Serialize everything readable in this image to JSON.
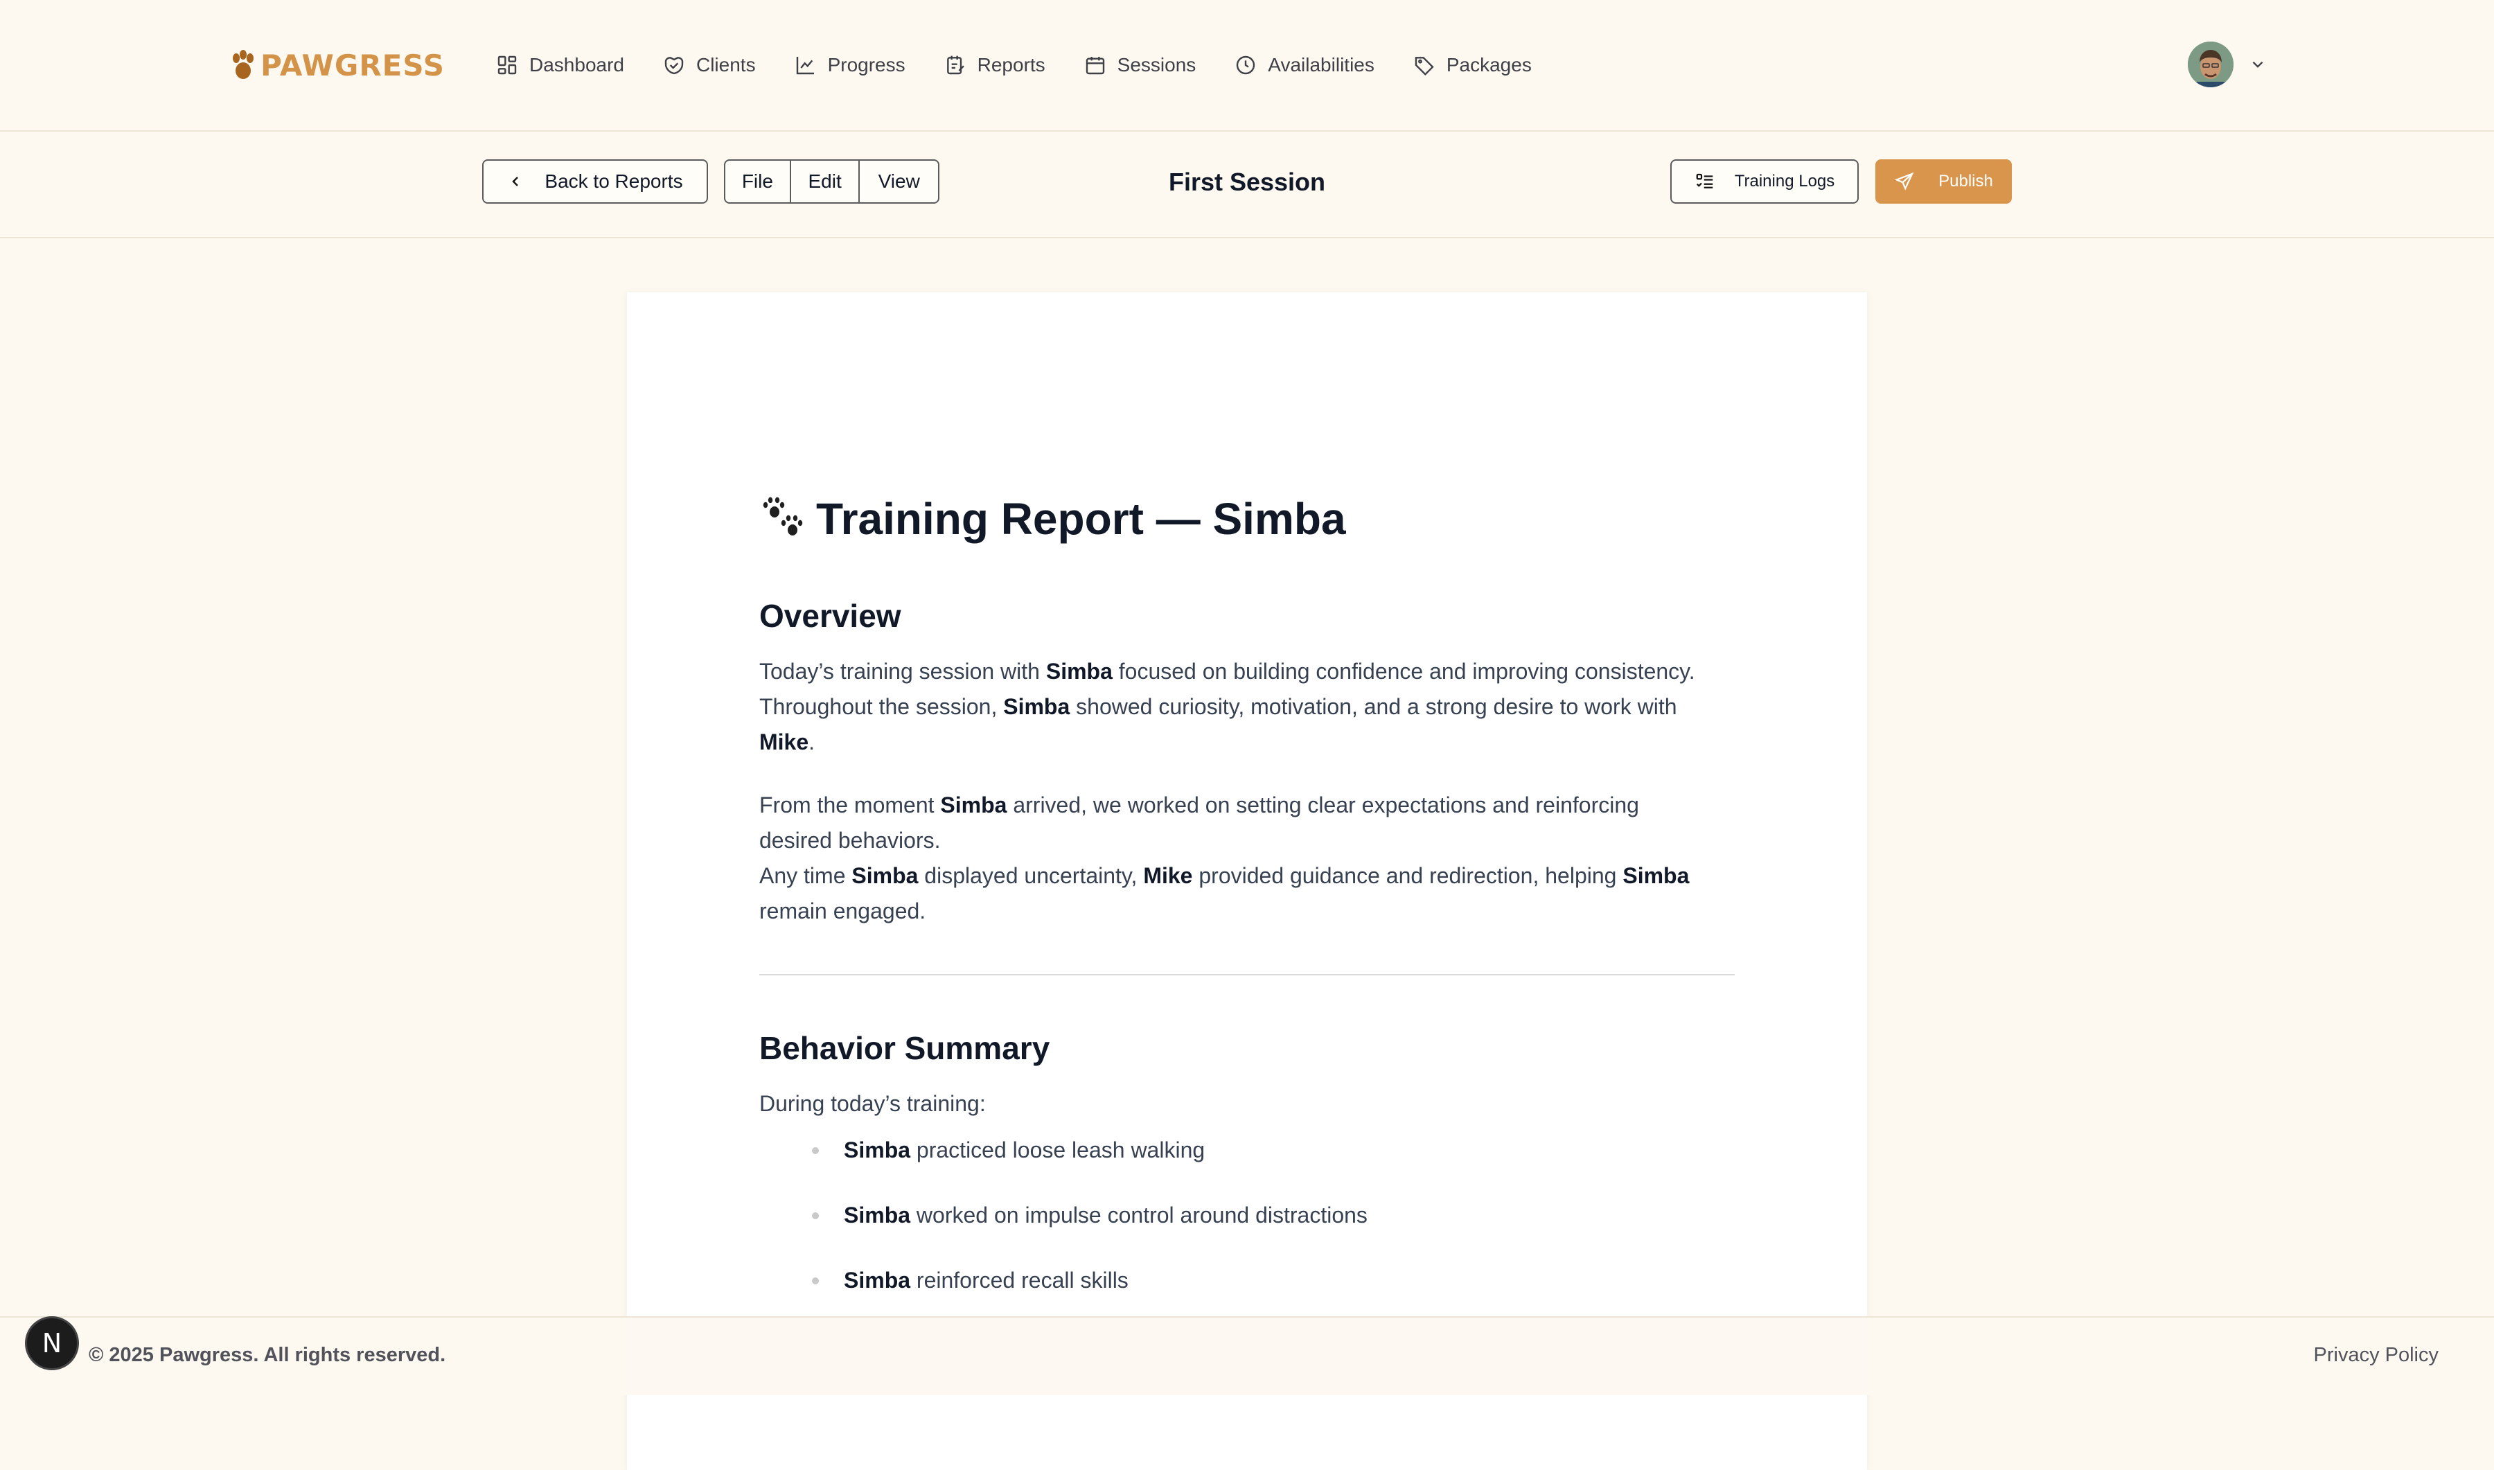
{
  "brand": {
    "name": "PAWGRESS"
  },
  "nav": {
    "items": [
      {
        "label": "Dashboard",
        "icon": "dashboard-icon"
      },
      {
        "label": "Clients",
        "icon": "clients-icon"
      },
      {
        "label": "Progress",
        "icon": "progress-icon"
      },
      {
        "label": "Reports",
        "icon": "reports-icon"
      },
      {
        "label": "Sessions",
        "icon": "calendar-icon"
      },
      {
        "label": "Availabilities",
        "icon": "clock-icon"
      },
      {
        "label": "Packages",
        "icon": "tag-icon"
      }
    ]
  },
  "toolbar": {
    "back_label": "Back to Reports",
    "menu": [
      "File",
      "Edit",
      "View"
    ],
    "title": "First Session",
    "logs_label": "Training Logs",
    "publish_label": "Publish"
  },
  "document": {
    "title": "Training Report — Simba",
    "overview_heading": "Overview",
    "p1": {
      "a": "Today’s training session with ",
      "b": "Simba",
      "c": " focused on building confidence and improving consistency.",
      "d": "Throughout the session, ",
      "e": "Simba",
      "f": " showed curiosity, motivation, and a strong desire to work with",
      "g": "Mike",
      "h": "."
    },
    "p2": {
      "a": "From the moment ",
      "b": "Simba",
      "c": " arrived, we worked on setting clear expectations and reinforcing",
      "d": "desired behaviors."
    },
    "p3": {
      "a": "Any time ",
      "b": "Simba",
      "c": " displayed uncertainty, ",
      "d": "Mike",
      "e": " provided guidance and redirection, helping ",
      "f": "Simba",
      "g": "remain engaged."
    },
    "behavior_heading": "Behavior Summary",
    "behavior_intro": "During today’s training:",
    "bullets": [
      {
        "name": "Simba",
        "text": " practiced loose leash walking"
      },
      {
        "name": "Simba",
        "text": " worked on impulse control around distractions"
      },
      {
        "name": "Simba",
        "text": " reinforced recall skills"
      }
    ]
  },
  "footer": {
    "copyright": "© 2025 Pawgress. All rights reserved.",
    "privacy": "Privacy Policy",
    "badge": "N"
  },
  "colors": {
    "accent": "#d9954b",
    "background": "#fdf9f1"
  }
}
